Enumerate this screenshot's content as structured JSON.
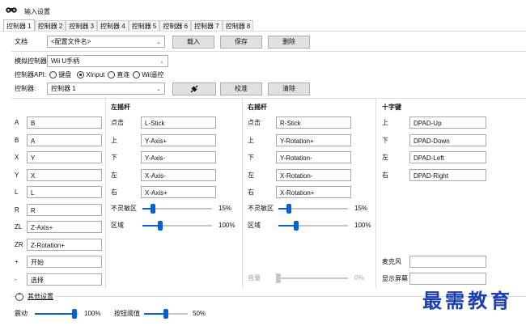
{
  "window": {
    "title": "输入设置"
  },
  "tabs": [
    "控制器 1",
    "控制器 2",
    "控制器 3",
    "控制器 4",
    "控制器 5",
    "控制器 6",
    "控制器 7",
    "控制器 8"
  ],
  "profile": {
    "label": "文档",
    "value": "<配置文件名>",
    "load": "载入",
    "save": "保存",
    "delete": "删除"
  },
  "emulated": {
    "label": "模拟控制器",
    "value": "Wii U手柄"
  },
  "api": {
    "label": "控制器API:",
    "options": [
      "键盘",
      "XInput",
      "直连",
      "Wii遥控"
    ],
    "selected": "XInput"
  },
  "device": {
    "label": "控制器:",
    "value": "控制器 1",
    "calibrate": "校准",
    "clear": "清除"
  },
  "buttons": [
    {
      "key": "A",
      "value": "B"
    },
    {
      "key": "B",
      "value": "A"
    },
    {
      "key": "X",
      "value": "Y"
    },
    {
      "key": "Y",
      "value": "X"
    },
    {
      "key": "L",
      "value": "L"
    },
    {
      "key": "R",
      "value": "R"
    },
    {
      "key": "ZL",
      "value": "Z-Axis+"
    },
    {
      "key": "ZR",
      "value": "Z-Rotation+"
    },
    {
      "key": "+",
      "value": "开始"
    },
    {
      "key": "-",
      "value": "选择"
    }
  ],
  "left_stick": {
    "title": "左摇杆",
    "rows": [
      {
        "key": "点击",
        "value": "L-Stick"
      },
      {
        "key": "上",
        "value": "Y-Axis+"
      },
      {
        "key": "下",
        "value": "Y-Axis-"
      },
      {
        "key": "左",
        "value": "X-Axis-"
      },
      {
        "key": "右",
        "value": "X-Axis+"
      }
    ],
    "deadzone": {
      "label": "不灵敏区",
      "value": "15%",
      "level": 0.15
    },
    "range": {
      "label": "区域",
      "value": "100%",
      "level": 0.25
    }
  },
  "right_stick": {
    "title": "右摇杆",
    "rows": [
      {
        "key": "点击",
        "value": "R-Stick"
      },
      {
        "key": "上",
        "value": "Y-Rotation+"
      },
      {
        "key": "下",
        "value": "Y-Rotation-"
      },
      {
        "key": "左",
        "value": "X-Rotation-"
      },
      {
        "key": "右",
        "value": "X-Rotation+"
      }
    ],
    "deadzone": {
      "label": "不灵敏区",
      "value": "15%",
      "level": 0.15
    },
    "range": {
      "label": "区域",
      "value": "100%",
      "level": 0.25
    },
    "volume": {
      "label": "音量",
      "value": "0%",
      "level": 0
    }
  },
  "dpad": {
    "title": "十字键",
    "rows": [
      {
        "key": "上",
        "value": "DPAD-Up"
      },
      {
        "key": "下",
        "value": "DPAD-Down"
      },
      {
        "key": "左",
        "value": "DPAD-Left"
      },
      {
        "key": "右",
        "value": "DPAD-Right"
      }
    ],
    "mic": {
      "label": "麦克风",
      "value": ""
    },
    "screen": {
      "label": "显示屏幕",
      "value": ""
    }
  },
  "more": {
    "label": "其他设置"
  },
  "bottom": {
    "rumble": {
      "label": "震动",
      "value": "100%",
      "level": 0.9
    },
    "threshold": {
      "label": "按钮阈值",
      "value": "50%",
      "level": 0.5
    }
  },
  "watermark": "最需教育",
  "colors": {
    "accent": "#0a5fd1",
    "watermark": "#1b3fb0"
  }
}
